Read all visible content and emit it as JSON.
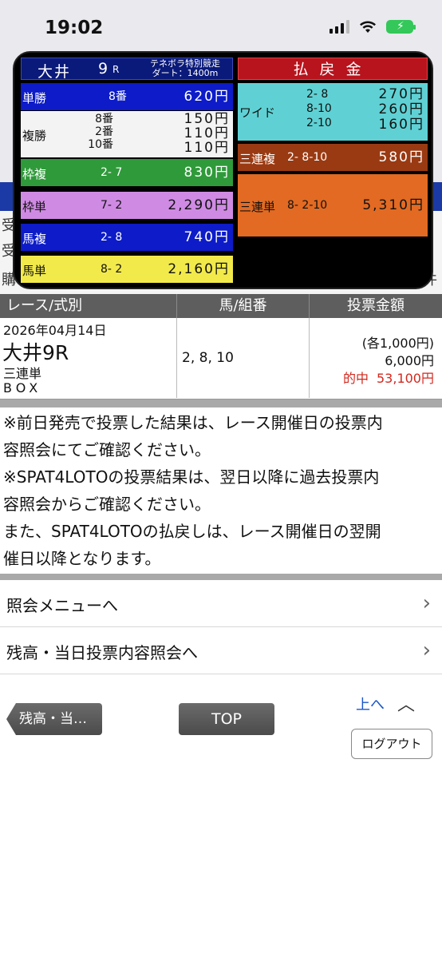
{
  "status_bar": {
    "time": "19:02"
  },
  "background_rows": {
    "row1": "受",
    "row2": "受",
    "row3": "購",
    "row3_right": "件"
  },
  "board": {
    "venue": "大井",
    "race_number": "9",
    "race_suffix": "R",
    "race_name_line1": "テネボラ特別競走",
    "race_name_line2": "ダート：1400m",
    "payout_title": "払戻金",
    "tansho": {
      "label": "単勝",
      "combo": "8番",
      "amount": "620円"
    },
    "fukusho": {
      "label": "複勝",
      "combos": [
        "8番",
        "2番",
        "10番"
      ],
      "amounts": [
        "150円",
        "110円",
        "110円"
      ]
    },
    "wakufuku": {
      "label": "枠複",
      "combo": "2- 7",
      "amount": "830円"
    },
    "wakutan": {
      "label": "枠単",
      "combo": "7- 2",
      "amount": "2,290円"
    },
    "umafuku": {
      "label": "馬複",
      "combo": "2- 8",
      "amount": "740円"
    },
    "umatan": {
      "label": "馬単",
      "combo": "8- 2",
      "amount": "2,160円"
    },
    "wide": {
      "label": "ワイド",
      "combos": [
        "2- 8",
        "8-10",
        "2-10"
      ],
      "amounts": [
        "270円",
        "260円",
        "160円"
      ]
    },
    "sanrenfuku": {
      "label": "三連複",
      "combo": "2- 8-10",
      "amount": "580円"
    },
    "sanrentan": {
      "label": "三連単",
      "combo": "8- 2-10",
      "amount": "5,310円"
    }
  },
  "table": {
    "headers": [
      "レース/式別",
      "馬/組番",
      "投票金額"
    ],
    "row": {
      "date": "2026年04月14日",
      "race": "大井9R",
      "bet_type": "三連単",
      "bet_method": "BOX",
      "horses": "2, 8, 10",
      "unit_amount": "(各1,000円)",
      "total_amount": "6,000円",
      "hit_label": "的中",
      "hit_amount": "53,100円"
    }
  },
  "notes": {
    "line1": "※前日発売で投票した結果は、レース開催日の投票内",
    "line2": "容照会にてご確認ください。",
    "line3": "※SPAT4LOTOの投票結果は、翌日以降に過去投票内",
    "line4": "容照会からご確認ください。",
    "line5": "また、SPAT4LOTOの払戻しは、レース開催日の翌開",
    "line6": "催日以降となります。"
  },
  "menu": {
    "item1": "照会メニューへ",
    "item2": "残高・当日投票内容照会へ"
  },
  "footer": {
    "back_label": "残高・当…",
    "top_label": "TOP",
    "up_label": "上へ",
    "logout_label": "ログアウト"
  }
}
